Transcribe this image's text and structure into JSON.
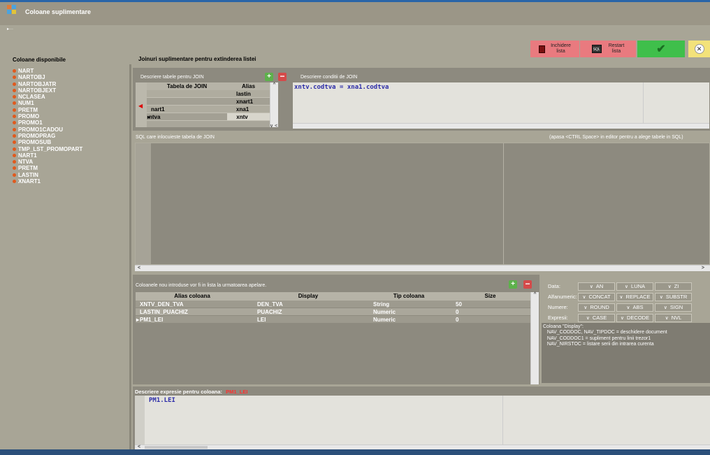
{
  "app": {
    "title": "Coloane suplimentare"
  },
  "left": {
    "header": "Coloane disponibile",
    "items": [
      "NART",
      "NARTOBJ",
      "NARTOBJATR",
      "NARTOBJEXT",
      "NCLASEA",
      "NUM1",
      "PRETM",
      "PROMO",
      "PROMO1",
      "PROMO1CADOU",
      "PROMOPRAG",
      "PROMOSUB",
      "TMP_LST_PROMOPART",
      "NART1",
      "NTVA",
      "PRETM",
      "LASTIN",
      "XNART1"
    ]
  },
  "main": {
    "header": "Joinuri suplimentare pentru extinderea listei"
  },
  "toolbar": {
    "close_label_1": "Inchidere",
    "close_label_2": "lista",
    "restart_label_1": "Restart",
    "restart_label_2": "lista",
    "colors": {
      "close": "#e97a7f",
      "restart": "#e97a7f",
      "ok": "#3fbf4b",
      "cancel": "#f3e27a"
    }
  },
  "join": {
    "tables_label": "Descriere tabele pentru JOIN",
    "conditions_label": "Descriere conditii de JOIN",
    "columns": [
      "Tabela de JOIN",
      "Alias"
    ],
    "rows": [
      {
        "table": "",
        "alias": "lastin"
      },
      {
        "table": "",
        "alias": "xnart1"
      },
      {
        "table": "nart1",
        "alias": "xna1"
      },
      {
        "table": "ntva",
        "alias": "xntv"
      }
    ],
    "condition_text": "xntv.codtva = xna1.codtva"
  },
  "sql": {
    "label": "SQL care inlocuieste tabela de JOIN",
    "hint": "(apasa <CTRL Space> in editor pentru a alege tabele in SQL)"
  },
  "newcols": {
    "label": "Coloanele nou introduse vor fi in lista la urmatoarea apelare.",
    "columns": [
      "Alias coloana",
      "Display",
      "Tip coloana",
      "Size"
    ],
    "rows": [
      {
        "alias": "XNTV_DEN_TVA",
        "display": "DEN_TVA",
        "type": "String",
        "size": "50"
      },
      {
        "alias": "LASTIN_PUACHIZ",
        "display": "PUACHIZ",
        "type": "Numeric",
        "size": "0"
      },
      {
        "alias": "PM1_LEI",
        "display": "LEI",
        "type": "Numeric",
        "size": "0"
      }
    ]
  },
  "functions": {
    "rows": [
      {
        "label": "Data:",
        "buttons": [
          "AN",
          "LUNA",
          "ZI"
        ]
      },
      {
        "label": "Alfanumeric:",
        "buttons": [
          "CONCAT",
          "REPLACE",
          "SUBSTR"
        ]
      },
      {
        "label": "Numere:",
        "buttons": [
          "ROUND",
          "ABS",
          "SIGN"
        ]
      },
      {
        "label": "Expresii:",
        "buttons": [
          "CASE",
          "DECODE",
          "NVL"
        ]
      }
    ],
    "info_lines": [
      "Coloana \"Display\":",
      "   NAV_CODDOC, NAV_TIPDOC = deschidere document",
      "   NAV_CODDOC1 = supliment pentru linii trezor1",
      "   NAV_NIRSTOC = listare serii din intrarea curenta"
    ]
  },
  "expr": {
    "label": "Descriere expresie pentru coloana:",
    "column": "PM1_LEI",
    "text": "PM1.LEI"
  }
}
